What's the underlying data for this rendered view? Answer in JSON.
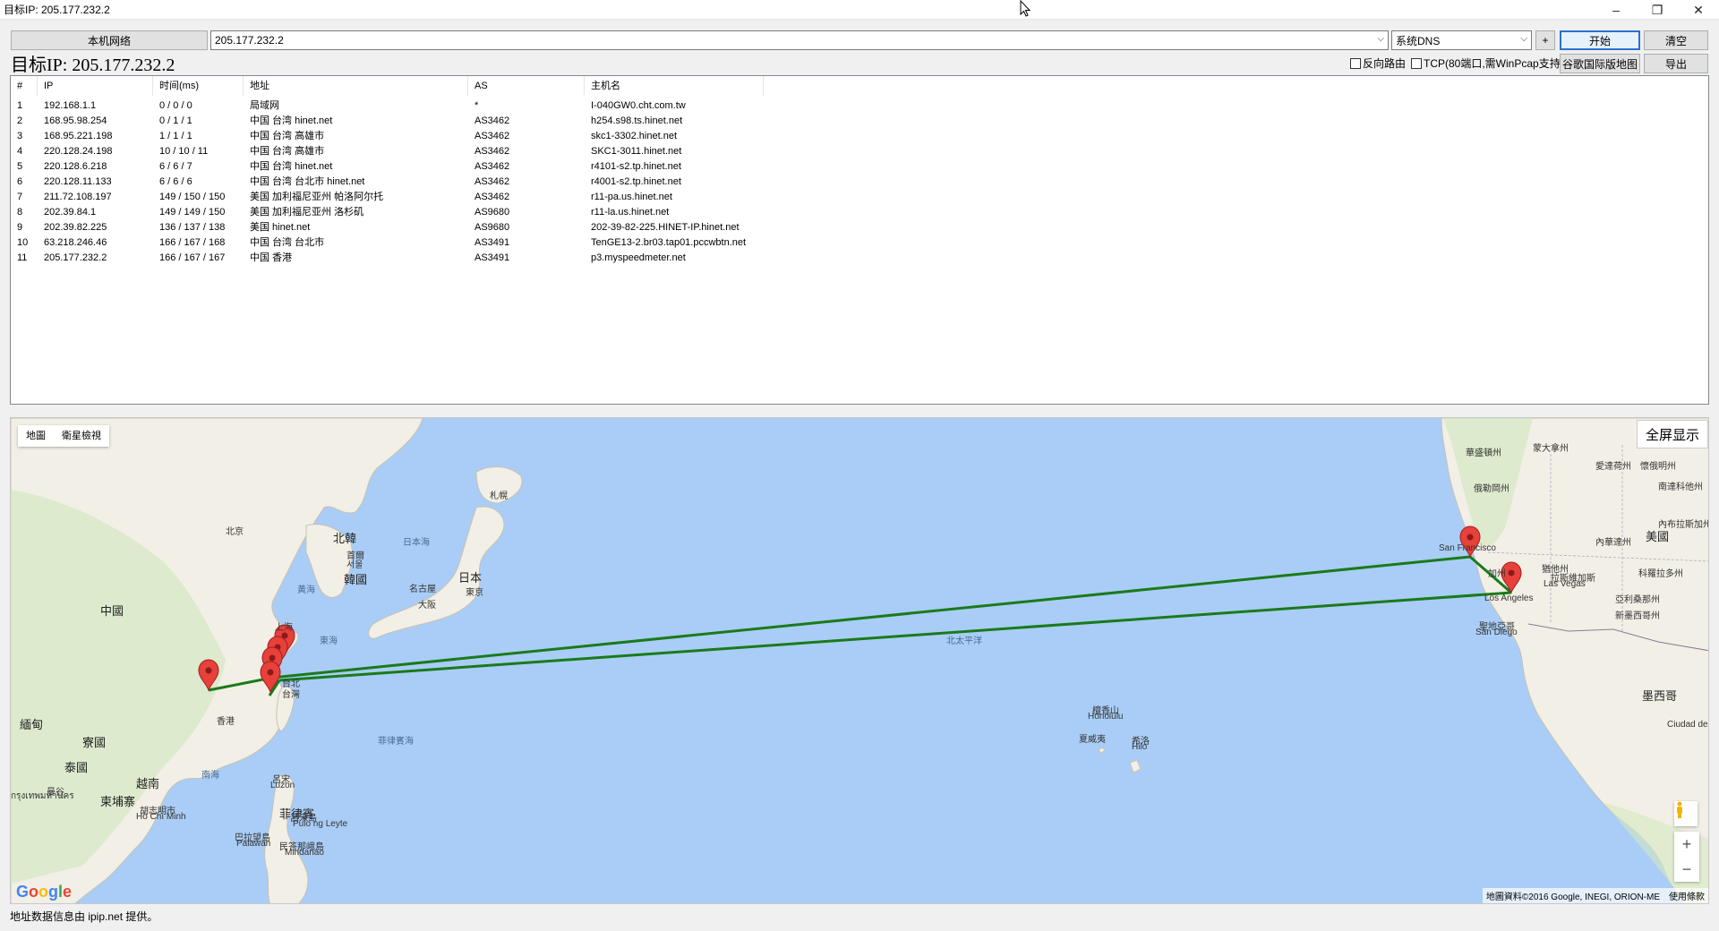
{
  "window": {
    "title": "目标IP: 205.177.232.2",
    "minimize": "–",
    "restore": "❐",
    "close": "✕"
  },
  "toolbar": {
    "local_network_label": "本机网络",
    "target_input_value": "205.177.232.2",
    "dns_select_value": "系统DNS",
    "plus_label": "+",
    "start_label": "开始",
    "clear_label": "清空",
    "export_label": "导出",
    "google_map_label": "谷歌国际版地图",
    "reverse_route_label": "反向路由",
    "tcp_label": "TCP(80端口,需WinPcap支持)"
  },
  "target_heading": "目标IP: 205.177.232.2",
  "table": {
    "headers": [
      "#",
      "IP",
      "时间(ms)",
      "地址",
      "AS",
      "主机名"
    ],
    "rows": [
      [
        "1",
        "192.168.1.1",
        "0 / 0 / 0",
        "局域网",
        "*",
        "I-040GW0.cht.com.tw"
      ],
      [
        "2",
        "168.95.98.254",
        "0 / 1 / 1",
        "中国 台湾 hinet.net",
        "AS3462",
        "h254.s98.ts.hinet.net"
      ],
      [
        "3",
        "168.95.221.198",
        "1 / 1 / 1",
        "中国 台湾 高雄市",
        "AS3462",
        "skc1-3302.hinet.net"
      ],
      [
        "4",
        "220.128.24.198",
        "10 / 10 / 11",
        "中国 台湾 高雄市",
        "AS3462",
        "SKC1-3011.hinet.net"
      ],
      [
        "5",
        "220.128.6.218",
        "6 / 6 / 7",
        "中国 台湾 hinet.net",
        "AS3462",
        "r4101-s2.tp.hinet.net"
      ],
      [
        "6",
        "220.128.11.133",
        "6 / 6 / 6",
        "中国 台湾 台北市 hinet.net",
        "AS3462",
        "r4001-s2.tp.hinet.net"
      ],
      [
        "7",
        "211.72.108.197",
        "149 / 150 / 150",
        "美国 加利福尼亚州 帕洛阿尔托",
        "AS3462",
        "r11-pa.us.hinet.net"
      ],
      [
        "8",
        "202.39.84.1",
        "149 / 149 / 150",
        "美国 加利福尼亚州 洛杉矶",
        "AS9680",
        "r11-la.us.hinet.net"
      ],
      [
        "9",
        "202.39.82.225",
        "136 / 137 / 138",
        "美国 hinet.net",
        "AS9680",
        "202-39-82-225.HINET-IP.hinet.net"
      ],
      [
        "10",
        "63.218.246.46",
        "166 / 167 / 168",
        "中国 台湾 台北市",
        "AS3491",
        "TenGE13-2.br03.tap01.pccwbtn.net"
      ],
      [
        "11",
        "205.177.232.2",
        "166 / 167 / 167",
        "中国 香港",
        "AS3491",
        "p3.myspeedmeter.net"
      ]
    ]
  },
  "map": {
    "type_map": "地圖",
    "type_satellite": "衛星檢視",
    "fullscreen_label": "全屏显示",
    "zoom_in": "+",
    "zoom_out": "−",
    "attribution": "地圖資料©2016 Google, INEGI, ORION-ME",
    "terms": "使用條款",
    "logo_letters": [
      "G",
      "o",
      "o",
      "g",
      "l",
      "e"
    ],
    "route_color": "#1a7a1a",
    "marker_color": "#e8403a",
    "labels": [
      {
        "text": "中國",
        "cls": "big"
      },
      {
        "text": "北京",
        "cls": ""
      },
      {
        "text": "北韓",
        "cls": "big"
      },
      {
        "text": "首爾",
        "cls": ""
      },
      {
        "text": "서울",
        "cls": ""
      },
      {
        "text": "韓國",
        "cls": "big"
      },
      {
        "text": "日本海",
        "cls": "sea"
      },
      {
        "text": "札幌",
        "cls": ""
      },
      {
        "text": "日本",
        "cls": "big"
      },
      {
        "text": "名古屋",
        "cls": ""
      },
      {
        "text": "東京",
        "cls": ""
      },
      {
        "text": "大阪",
        "cls": ""
      },
      {
        "text": "黃海",
        "cls": "sea"
      },
      {
        "text": "上海",
        "cls": ""
      },
      {
        "text": "東海",
        "cls": "sea"
      },
      {
        "text": "台北",
        "cls": ""
      },
      {
        "text": "台灣",
        "cls": ""
      },
      {
        "text": "香港",
        "cls": ""
      },
      {
        "text": "緬甸",
        "cls": "big"
      },
      {
        "text": "寮國",
        "cls": "big"
      },
      {
        "text": "泰國",
        "cls": "big"
      },
      {
        "text": "越南",
        "cls": "big"
      },
      {
        "text": "柬埔寨",
        "cls": "big"
      },
      {
        "text": "曼谷",
        "cls": ""
      },
      {
        "text": "กรุงเทพมหานคร",
        "cls": ""
      },
      {
        "text": "胡志明市",
        "cls": ""
      },
      {
        "text": "Hồ Chí Minh",
        "cls": ""
      },
      {
        "text": "南海",
        "cls": "sea"
      },
      {
        "text": "菲律賓海",
        "cls": "sea"
      },
      {
        "text": "呂宋",
        "cls": ""
      },
      {
        "text": "Luzon",
        "cls": ""
      },
      {
        "text": "菲律賓",
        "cls": "big"
      },
      {
        "text": "呂宋島",
        "cls": ""
      },
      {
        "text": "Pulo ng Leyte",
        "cls": ""
      },
      {
        "text": "巴拉望島",
        "cls": ""
      },
      {
        "text": "Palawan",
        "cls": ""
      },
      {
        "text": "民答那峨島",
        "cls": ""
      },
      {
        "text": "Mindanao",
        "cls": ""
      },
      {
        "text": "北太平洋",
        "cls": "sea"
      },
      {
        "text": "檀香山",
        "cls": ""
      },
      {
        "text": "Honolulu",
        "cls": ""
      },
      {
        "text": "夏威夷",
        "cls": ""
      },
      {
        "text": "希洛",
        "cls": ""
      },
      {
        "text": "Hilo",
        "cls": ""
      },
      {
        "text": "San Francisco",
        "cls": ""
      },
      {
        "text": "Los Angeles",
        "cls": ""
      },
      {
        "text": "聖地亞哥",
        "cls": ""
      },
      {
        "text": "San Diego",
        "cls": ""
      },
      {
        "text": "拉斯維加斯",
        "cls": ""
      },
      {
        "text": "Las Vegas",
        "cls": ""
      },
      {
        "text": "美國",
        "cls": "big"
      },
      {
        "text": "墨西哥",
        "cls": "big"
      },
      {
        "text": "愛達荷州",
        "cls": ""
      },
      {
        "text": "懷俄明州",
        "cls": ""
      },
      {
        "text": "內華達州",
        "cls": ""
      },
      {
        "text": "猶他州",
        "cls": ""
      },
      {
        "text": "科羅拉多州",
        "cls": ""
      },
      {
        "text": "亞利桑那州",
        "cls": ""
      },
      {
        "text": "新墨西哥州",
        "cls": ""
      },
      {
        "text": "俄勒岡州",
        "cls": ""
      },
      {
        "text": "加州",
        "cls": ""
      },
      {
        "text": "華盛頓州",
        "cls": ""
      },
      {
        "text": "蒙大拿州",
        "cls": ""
      },
      {
        "text": "南達科他州",
        "cls": ""
      },
      {
        "text": "內布拉斯加州",
        "cls": ""
      },
      {
        "text": "Ciudad de México",
        "cls": ""
      }
    ]
  },
  "status": "地址数据信息由 ipip.net 提供。"
}
